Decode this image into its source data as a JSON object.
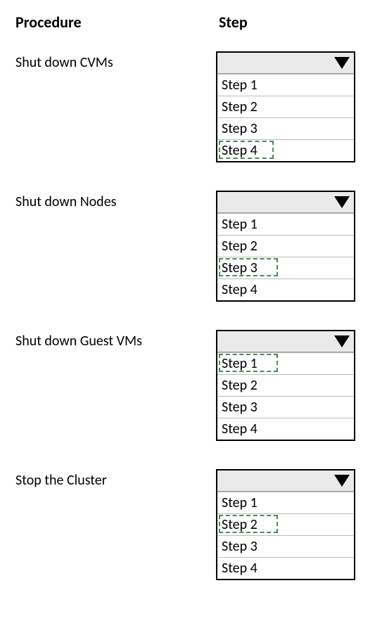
{
  "headers": {
    "left": "Procedure",
    "right": "Step"
  },
  "rows": [
    {
      "label": "Shut  down CVMs",
      "options": [
        "Step 1",
        "Step 2",
        "Step 3",
        "Step 4"
      ],
      "highlight_index": 3,
      "highlight_width": 78
    },
    {
      "label": "Shut down Nodes",
      "options": [
        "Step 1",
        "Step 2",
        "Step 3",
        "Step 4"
      ],
      "highlight_index": 2,
      "highlight_width": 84
    },
    {
      "label": "Shut down Guest VMs",
      "options": [
        "Step 1",
        "Step 2",
        "Step 3",
        "Step 4"
      ],
      "highlight_index": 0,
      "highlight_width": 84
    },
    {
      "label": "Stop the Cluster",
      "options": [
        "Step 1",
        "Step 2",
        "Step 3",
        "Step 4"
      ],
      "highlight_index": 1,
      "highlight_width": 84
    }
  ]
}
